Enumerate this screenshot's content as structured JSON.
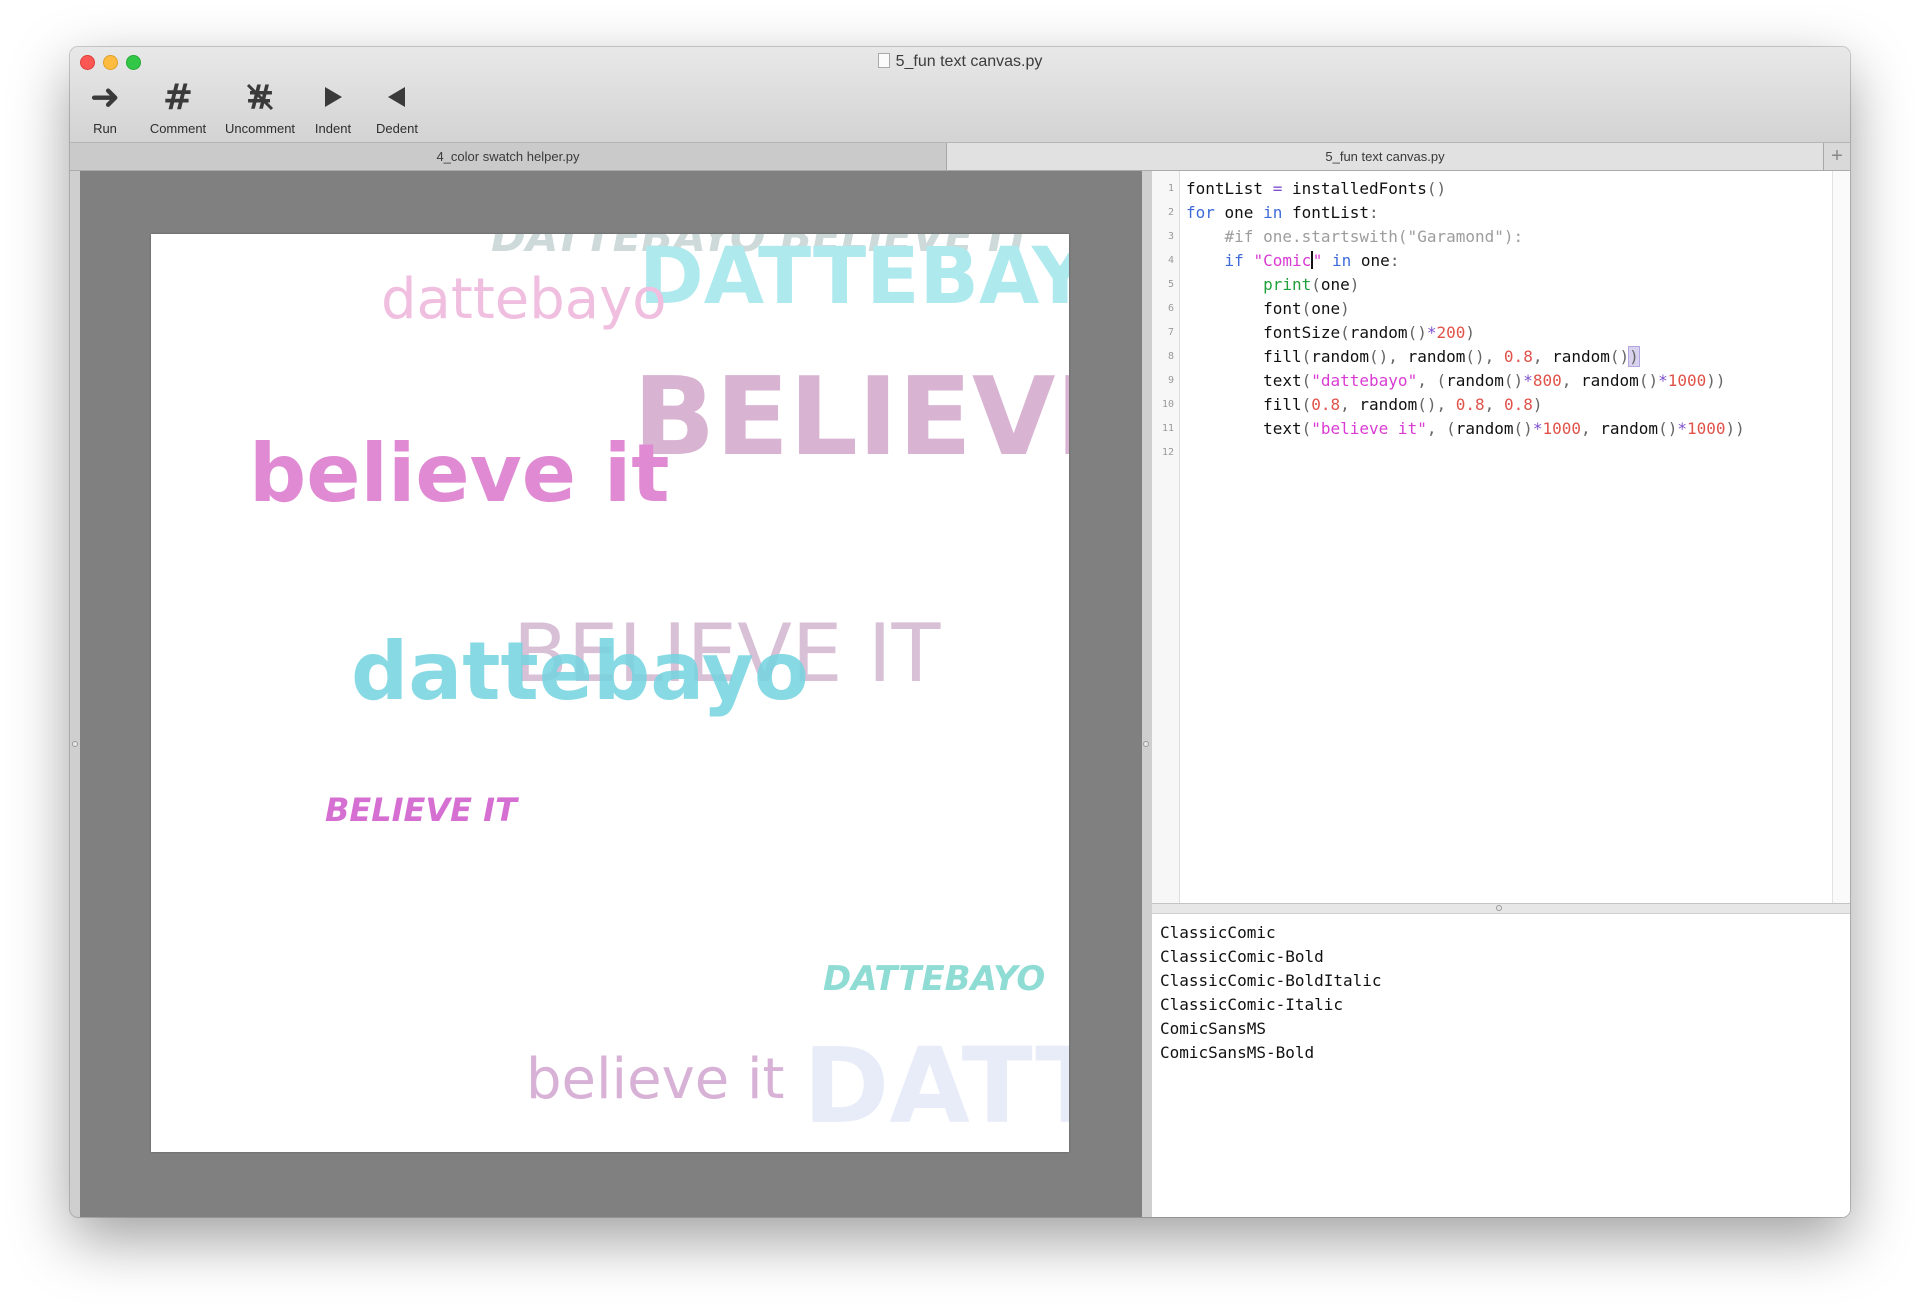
{
  "window": {
    "title": "5_fun text canvas.py",
    "traffic_lights": [
      "close",
      "minimize",
      "maximize"
    ]
  },
  "toolbar": {
    "buttons": [
      {
        "label": "Run",
        "icon": "arrow-right-icon"
      },
      {
        "label": "Comment",
        "icon": "hash-icon"
      },
      {
        "label": "Uncomment",
        "icon": "hash-slash-icon"
      },
      {
        "label": "Indent",
        "icon": "triangle-right-icon"
      },
      {
        "label": "Dedent",
        "icon": "triangle-left-icon"
      }
    ]
  },
  "tabs": [
    {
      "label": "4_color swatch helper.py",
      "active": false
    },
    {
      "label": "5_fun text canvas.py",
      "active": true
    }
  ],
  "canvas": {
    "texts": [
      {
        "text": "DATTEBAYO BELIEVE IT",
        "color": "#9fb4b4"
      },
      {
        "text": "DATTEBAYO",
        "color": "#aee9ee"
      },
      {
        "text": "dattebayo",
        "color": "#f0bfe0"
      },
      {
        "text": "BELIEVE IT",
        "color": "#d8b4d2"
      },
      {
        "text": "believe it",
        "color": "#e08ad3"
      },
      {
        "text": "BELIEVE IT",
        "color": "#d8c0d6"
      },
      {
        "text": "dattebayo",
        "color": "#73d4e0"
      },
      {
        "text": "BELIEVE IT",
        "color": "#d66fd2"
      },
      {
        "text": "DATTEBAYO",
        "color": "#8fdcd4"
      },
      {
        "text": "believe it",
        "color": "#d8b1d6"
      },
      {
        "text": "DATT",
        "color": "#e8ecf8"
      }
    ]
  },
  "editor": {
    "line_numbers": [
      "1",
      "2",
      "3",
      "4",
      "5",
      "6",
      "7",
      "8",
      "9",
      "10",
      "11",
      "12"
    ],
    "cursor_line": 4
  },
  "output": {
    "lines": [
      "ClassicComic",
      "ClassicComic-Bold",
      "ClassicComic-BoldItalic",
      "ClassicComic-Italic",
      "ComicSansMS",
      "ComicSansMS-Bold"
    ]
  },
  "colors": {
    "keyword": "#3e6bd9",
    "builtin": "#22a03c",
    "number": "#e0524a",
    "string": "#d93bd3",
    "comment": "#9d9d9d",
    "operator": "#7e4fcf",
    "canvas_background": "#808080"
  }
}
